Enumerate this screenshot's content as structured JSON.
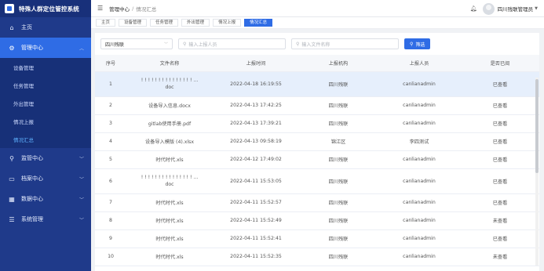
{
  "app": {
    "title": "特殊人群定位管控系统"
  },
  "sidebar": {
    "items": [
      {
        "label": "主页",
        "icon": "home-icon",
        "glyph": "⌂"
      },
      {
        "label": "管理中心",
        "icon": "gear-icon",
        "glyph": "⚙",
        "expanded": true
      },
      {
        "label": "监管中心",
        "icon": "location-pin-icon",
        "glyph": "⚲"
      },
      {
        "label": "档案中心",
        "icon": "folder-icon",
        "glyph": "▭"
      },
      {
        "label": "数据中心",
        "icon": "grid-icon",
        "glyph": "▦"
      },
      {
        "label": "系统管理",
        "icon": "sliders-icon",
        "glyph": "☰"
      }
    ],
    "submenu": [
      {
        "label": "设备管理"
      },
      {
        "label": "任务管理"
      },
      {
        "label": "外出管理"
      },
      {
        "label": "情况上报"
      },
      {
        "label": "情况汇总",
        "active": true
      }
    ]
  },
  "topbar": {
    "breadcrumb": [
      "管理中心",
      "情况汇总"
    ],
    "user": "四川残联管理员"
  },
  "tabs": [
    "主页",
    "设备管理",
    "任务管理",
    "外出管理",
    "情况上报",
    "情况汇总"
  ],
  "filters": {
    "region_value": "四川残联",
    "reporter_placeholder": "输入上报人员",
    "filename_placeholder": "输入文件名称",
    "search_label": "筛选"
  },
  "table": {
    "headers": [
      "序号",
      "文件名称",
      "上报时间",
      "上报机构",
      "上报人员",
      "是否已阅"
    ],
    "rows": [
      {
        "no": "1",
        "name": "! ! ! ! ! ! ! ! ! ! ! ! ! ! ! ...",
        "name2": "doc",
        "time": "2022-04-18 16:19:55",
        "org": "四川残联",
        "user": "canlianadmin",
        "read": "已查看"
      },
      {
        "no": "2",
        "name": "设备导入信息.docx",
        "time": "2022-04-13 17:42:25",
        "org": "四川残联",
        "user": "canlianadmin",
        "read": "已查看"
      },
      {
        "no": "3",
        "name": "gitlab使用手册.pdf",
        "time": "2022-04-13 17:39:21",
        "org": "四川残联",
        "user": "canlianadmin",
        "read": "已查看"
      },
      {
        "no": "4",
        "name": "设备导入模版 (4).xlsx",
        "time": "2022-04-13 09:58:19",
        "org": "锦江区",
        "user": "李四测试",
        "read": "已查看"
      },
      {
        "no": "5",
        "name": "时代时代.xls",
        "time": "2022-04-12 17:49:02",
        "org": "四川残联",
        "user": "canlianadmin",
        "read": "已查看"
      },
      {
        "no": "6",
        "name": "! ! ! ! ! ! ! ! ! ! ! ! ! ! ! ...",
        "name2": "doc",
        "time": "2022-04-11 15:53:05",
        "org": "四川残联",
        "user": "canlianadmin",
        "read": "已查看"
      },
      {
        "no": "7",
        "name": "时代时代.xls",
        "time": "2022-04-11 15:52:57",
        "org": "四川残联",
        "user": "canlianadmin",
        "read": "已查看"
      },
      {
        "no": "8",
        "name": "时代时代.xls",
        "time": "2022-04-11 15:52:49",
        "org": "四川残联",
        "user": "canlianadmin",
        "read": "未查看"
      },
      {
        "no": "9",
        "name": "时代时代.xls",
        "time": "2022-04-11 15:52:41",
        "org": "四川残联",
        "user": "canlianadmin",
        "read": "已查看"
      },
      {
        "no": "10",
        "name": "时代时代.xls",
        "time": "2022-04-11 15:52:35",
        "org": "四川残联",
        "user": "canlianadmin",
        "read": "未查看"
      }
    ]
  }
}
